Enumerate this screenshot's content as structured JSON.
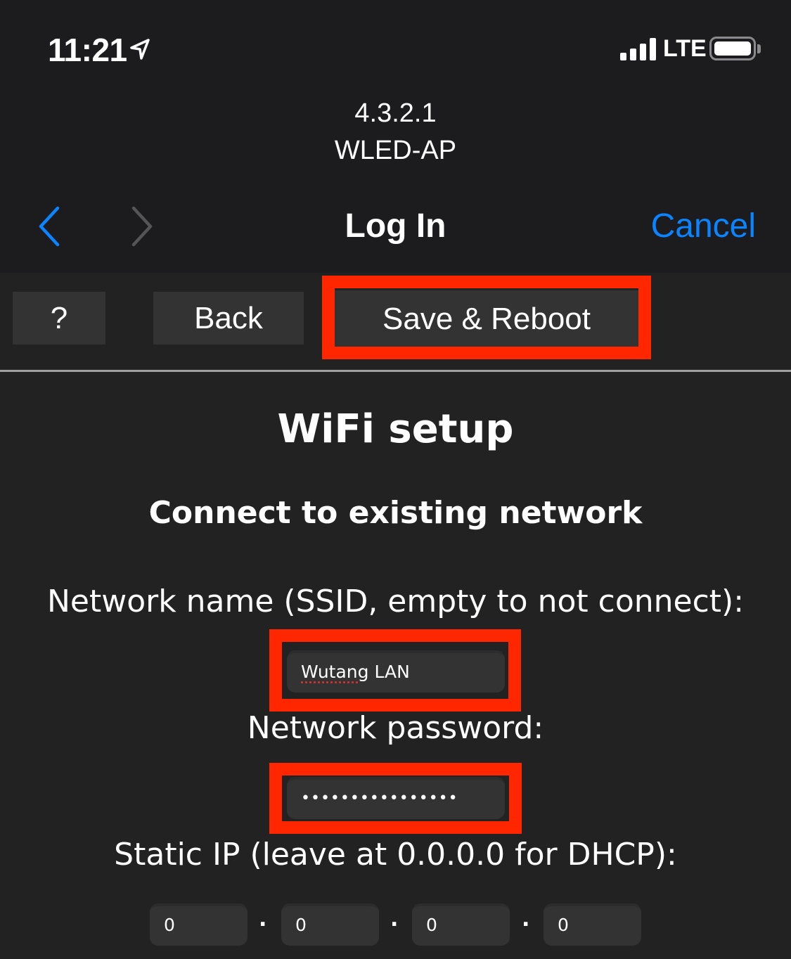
{
  "status_bar": {
    "time": "11:21",
    "network": "LTE",
    "signal_bars": 4,
    "location_icon": "location-arrow-icon",
    "battery_icon": "battery-icon"
  },
  "browser": {
    "host_ip": "4.3.2.1",
    "host_name": "WLED-AP",
    "title": "Log In",
    "cancel_label": "Cancel",
    "back_icon": "chevron-left-icon",
    "forward_icon": "chevron-right-icon",
    "accent_color": "#0a84ff"
  },
  "toolbar": {
    "help_label": "?",
    "back_label": "Back",
    "save_label": "Save & Reboot"
  },
  "page": {
    "title": "WiFi setup",
    "subtitle": "Connect to existing network",
    "ssid_label": "Network name (SSID, empty to not connect):",
    "ssid_value_word1": "Wutang",
    "ssid_value_word2": " LAN",
    "password_label": "Network password:",
    "password_mask": "••••••••••••••••",
    "static_ip_label": "Static IP (leave at 0.0.0.0 for DHCP):",
    "static_ip": [
      "0",
      "0",
      "0",
      "0"
    ],
    "ip_separator": "."
  },
  "annotations": {
    "highlight_color": "#ff2600",
    "highlighted": [
      "Save & Reboot button",
      "SSID field",
      "Password field"
    ]
  }
}
